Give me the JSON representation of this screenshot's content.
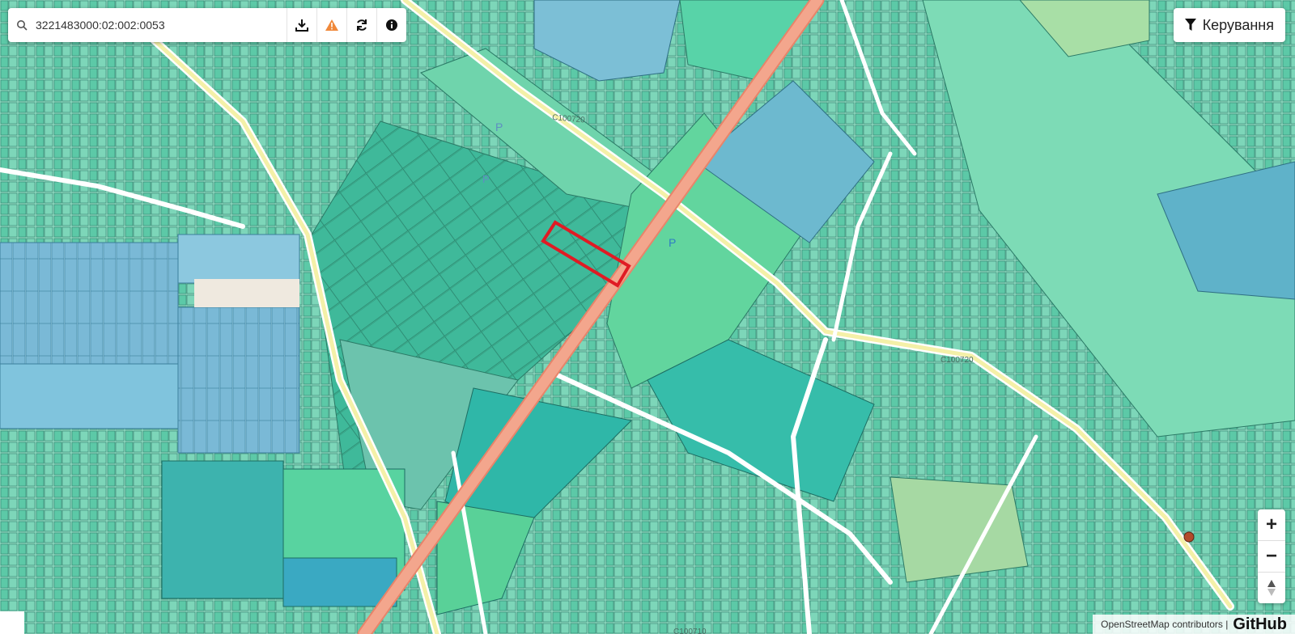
{
  "search": {
    "value": "3221483000:02:002:0053",
    "placeholder": ""
  },
  "toolbar": {
    "download_icon": "download-icon",
    "warning_icon": "warning-icon",
    "refresh_icon": "refresh-icon",
    "info_icon": "info-icon"
  },
  "control": {
    "label": "Керування",
    "icon": "filter-icon"
  },
  "zoom": {
    "in_label": "+",
    "out_label": "−",
    "compass_icon": "compass-icon"
  },
  "map_labels": {
    "road_c100720_a": "С100720",
    "road_c100720_b": "С100720",
    "road_c100710": "С100710",
    "parking_a": "P",
    "parking_b": "P",
    "parking_c": "P"
  },
  "attribution": {
    "text": "OpenStreetMap contributors |",
    "github": "GitHub"
  },
  "colors": {
    "parcel_green": "#5fd3a8",
    "parcel_teal": "#3fb9ad",
    "parcel_blue": "#6fb6d6",
    "highway": "#f0a58c",
    "selected_parcel": "#e01b24",
    "warning": "#f0883a"
  }
}
